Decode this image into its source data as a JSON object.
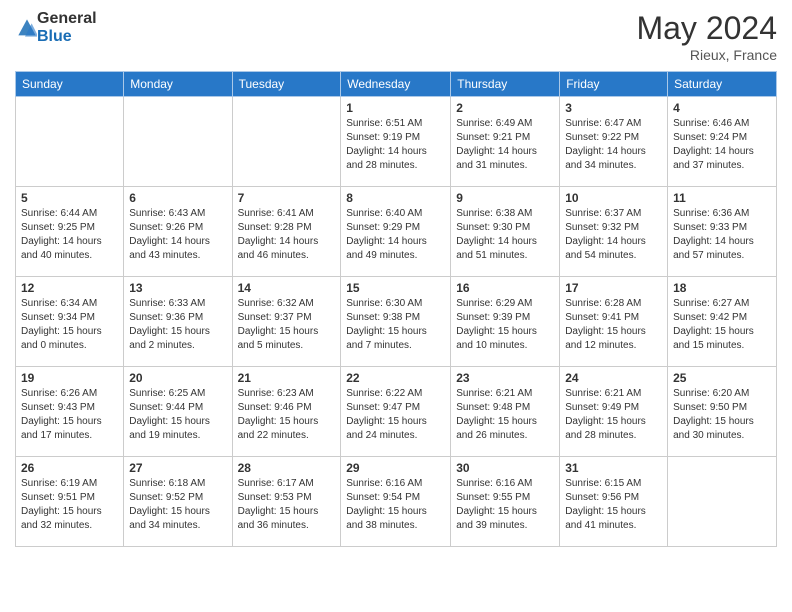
{
  "header": {
    "logo_general": "General",
    "logo_blue": "Blue",
    "month_year": "May 2024",
    "location": "Rieux, France"
  },
  "days_of_week": [
    "Sunday",
    "Monday",
    "Tuesday",
    "Wednesday",
    "Thursday",
    "Friday",
    "Saturday"
  ],
  "weeks": [
    [
      {
        "day": "",
        "sunrise": "",
        "sunset": "",
        "daylight": ""
      },
      {
        "day": "",
        "sunrise": "",
        "sunset": "",
        "daylight": ""
      },
      {
        "day": "",
        "sunrise": "",
        "sunset": "",
        "daylight": ""
      },
      {
        "day": "1",
        "sunrise": "Sunrise: 6:51 AM",
        "sunset": "Sunset: 9:19 PM",
        "daylight": "Daylight: 14 hours and 28 minutes."
      },
      {
        "day": "2",
        "sunrise": "Sunrise: 6:49 AM",
        "sunset": "Sunset: 9:21 PM",
        "daylight": "Daylight: 14 hours and 31 minutes."
      },
      {
        "day": "3",
        "sunrise": "Sunrise: 6:47 AM",
        "sunset": "Sunset: 9:22 PM",
        "daylight": "Daylight: 14 hours and 34 minutes."
      },
      {
        "day": "4",
        "sunrise": "Sunrise: 6:46 AM",
        "sunset": "Sunset: 9:24 PM",
        "daylight": "Daylight: 14 hours and 37 minutes."
      }
    ],
    [
      {
        "day": "5",
        "sunrise": "Sunrise: 6:44 AM",
        "sunset": "Sunset: 9:25 PM",
        "daylight": "Daylight: 14 hours and 40 minutes."
      },
      {
        "day": "6",
        "sunrise": "Sunrise: 6:43 AM",
        "sunset": "Sunset: 9:26 PM",
        "daylight": "Daylight: 14 hours and 43 minutes."
      },
      {
        "day": "7",
        "sunrise": "Sunrise: 6:41 AM",
        "sunset": "Sunset: 9:28 PM",
        "daylight": "Daylight: 14 hours and 46 minutes."
      },
      {
        "day": "8",
        "sunrise": "Sunrise: 6:40 AM",
        "sunset": "Sunset: 9:29 PM",
        "daylight": "Daylight: 14 hours and 49 minutes."
      },
      {
        "day": "9",
        "sunrise": "Sunrise: 6:38 AM",
        "sunset": "Sunset: 9:30 PM",
        "daylight": "Daylight: 14 hours and 51 minutes."
      },
      {
        "day": "10",
        "sunrise": "Sunrise: 6:37 AM",
        "sunset": "Sunset: 9:32 PM",
        "daylight": "Daylight: 14 hours and 54 minutes."
      },
      {
        "day": "11",
        "sunrise": "Sunrise: 6:36 AM",
        "sunset": "Sunset: 9:33 PM",
        "daylight": "Daylight: 14 hours and 57 minutes."
      }
    ],
    [
      {
        "day": "12",
        "sunrise": "Sunrise: 6:34 AM",
        "sunset": "Sunset: 9:34 PM",
        "daylight": "Daylight: 15 hours and 0 minutes."
      },
      {
        "day": "13",
        "sunrise": "Sunrise: 6:33 AM",
        "sunset": "Sunset: 9:36 PM",
        "daylight": "Daylight: 15 hours and 2 minutes."
      },
      {
        "day": "14",
        "sunrise": "Sunrise: 6:32 AM",
        "sunset": "Sunset: 9:37 PM",
        "daylight": "Daylight: 15 hours and 5 minutes."
      },
      {
        "day": "15",
        "sunrise": "Sunrise: 6:30 AM",
        "sunset": "Sunset: 9:38 PM",
        "daylight": "Daylight: 15 hours and 7 minutes."
      },
      {
        "day": "16",
        "sunrise": "Sunrise: 6:29 AM",
        "sunset": "Sunset: 9:39 PM",
        "daylight": "Daylight: 15 hours and 10 minutes."
      },
      {
        "day": "17",
        "sunrise": "Sunrise: 6:28 AM",
        "sunset": "Sunset: 9:41 PM",
        "daylight": "Daylight: 15 hours and 12 minutes."
      },
      {
        "day": "18",
        "sunrise": "Sunrise: 6:27 AM",
        "sunset": "Sunset: 9:42 PM",
        "daylight": "Daylight: 15 hours and 15 minutes."
      }
    ],
    [
      {
        "day": "19",
        "sunrise": "Sunrise: 6:26 AM",
        "sunset": "Sunset: 9:43 PM",
        "daylight": "Daylight: 15 hours and 17 minutes."
      },
      {
        "day": "20",
        "sunrise": "Sunrise: 6:25 AM",
        "sunset": "Sunset: 9:44 PM",
        "daylight": "Daylight: 15 hours and 19 minutes."
      },
      {
        "day": "21",
        "sunrise": "Sunrise: 6:23 AM",
        "sunset": "Sunset: 9:46 PM",
        "daylight": "Daylight: 15 hours and 22 minutes."
      },
      {
        "day": "22",
        "sunrise": "Sunrise: 6:22 AM",
        "sunset": "Sunset: 9:47 PM",
        "daylight": "Daylight: 15 hours and 24 minutes."
      },
      {
        "day": "23",
        "sunrise": "Sunrise: 6:21 AM",
        "sunset": "Sunset: 9:48 PM",
        "daylight": "Daylight: 15 hours and 26 minutes."
      },
      {
        "day": "24",
        "sunrise": "Sunrise: 6:21 AM",
        "sunset": "Sunset: 9:49 PM",
        "daylight": "Daylight: 15 hours and 28 minutes."
      },
      {
        "day": "25",
        "sunrise": "Sunrise: 6:20 AM",
        "sunset": "Sunset: 9:50 PM",
        "daylight": "Daylight: 15 hours and 30 minutes."
      }
    ],
    [
      {
        "day": "26",
        "sunrise": "Sunrise: 6:19 AM",
        "sunset": "Sunset: 9:51 PM",
        "daylight": "Daylight: 15 hours and 32 minutes."
      },
      {
        "day": "27",
        "sunrise": "Sunrise: 6:18 AM",
        "sunset": "Sunset: 9:52 PM",
        "daylight": "Daylight: 15 hours and 34 minutes."
      },
      {
        "day": "28",
        "sunrise": "Sunrise: 6:17 AM",
        "sunset": "Sunset: 9:53 PM",
        "daylight": "Daylight: 15 hours and 36 minutes."
      },
      {
        "day": "29",
        "sunrise": "Sunrise: 6:16 AM",
        "sunset": "Sunset: 9:54 PM",
        "daylight": "Daylight: 15 hours and 38 minutes."
      },
      {
        "day": "30",
        "sunrise": "Sunrise: 6:16 AM",
        "sunset": "Sunset: 9:55 PM",
        "daylight": "Daylight: 15 hours and 39 minutes."
      },
      {
        "day": "31",
        "sunrise": "Sunrise: 6:15 AM",
        "sunset": "Sunset: 9:56 PM",
        "daylight": "Daylight: 15 hours and 41 minutes."
      },
      {
        "day": "",
        "sunrise": "",
        "sunset": "",
        "daylight": ""
      }
    ]
  ]
}
